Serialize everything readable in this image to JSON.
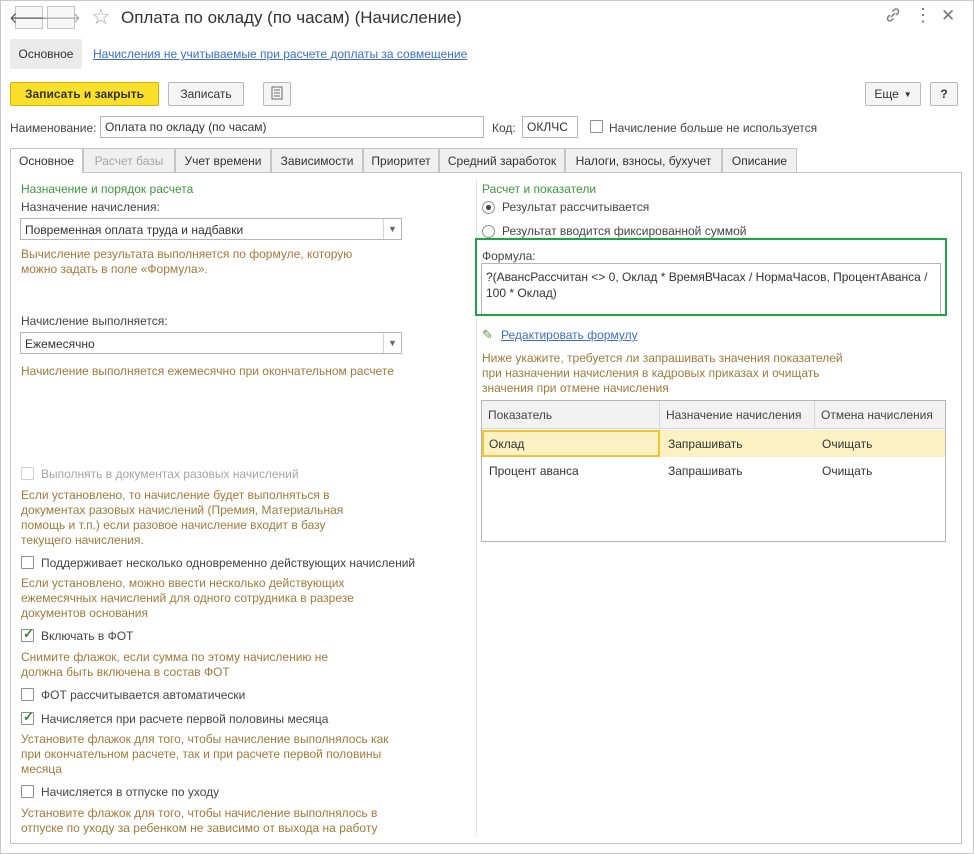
{
  "window": {
    "title": "Оплата по окладу (по часам) (Начисление)"
  },
  "section_nav": {
    "main": "Основное",
    "link": "Начисления не учитываемые при расчете доплаты за совмещение"
  },
  "toolbar": {
    "save_close": "Записать и закрыть",
    "save": "Записать",
    "more": "Еще",
    "help": "?"
  },
  "fields": {
    "name_label": "Наименование:",
    "name_value": "Оплата по окладу (по часам)",
    "code_label": "Код:",
    "code_value": "ОКЛЧС",
    "not_used_label": "Начисление больше не используется"
  },
  "tabs": [
    {
      "label": "Основное"
    },
    {
      "label": "Расчет базы"
    },
    {
      "label": "Учет времени"
    },
    {
      "label": "Зависимости"
    },
    {
      "label": "Приоритет"
    },
    {
      "label": "Средний заработок"
    },
    {
      "label": "Налоги, взносы, бухучет"
    },
    {
      "label": "Описание"
    }
  ],
  "left": {
    "group_title": "Назначение и порядок расчета",
    "purpose_label": "Назначение начисления:",
    "purpose_value": "Повременная оплата труда и надбавки",
    "purpose_hint": "Вычисление результата выполняется по формуле, которую можно задать в поле «Формула».",
    "period_label": "Начисление выполняется:",
    "period_value": "Ежемесячно",
    "period_hint": "Начисление выполняется ежемесячно при окончательном расчете",
    "cb1_label": "Выполнять в документах разовых начислений",
    "cb1_hint": "Если установлено, то начисление будет выполняться в документах разовых начислений (Премия, Материальная помощь и т.п.) если разовое начисление входит в базу текущего начисления.",
    "cb2_label": "Поддерживает несколько одновременно действующих начислений",
    "cb2_hint": "Если установлено, можно ввести несколько действующих ежемесячных начислений для одного сотрудника в разрезе документов основания",
    "cb3_label": "Включать в ФОТ",
    "cb3_hint": "Снимите флажок, если сумма по этому начислению не должна быть включена в состав ФОТ",
    "cb4_label": "ФОТ рассчитывается автоматически",
    "cb5_label": "Начисляется при расчете первой половины месяца",
    "cb5_hint": "Установите флажок для того, чтобы начисление выполнялось как при окончательном расчете, так и при расчете первой половины месяца",
    "cb6_label": "Начисляется в отпуске по уходу",
    "cb6_hint": "Установите флажок для того, чтобы начисление выполнялось в отпуске по уходу за ребенком не зависимо от выхода на работу"
  },
  "right": {
    "group_title": "Расчет и показатели",
    "radio1": "Результат рассчитывается",
    "radio2": "Результат вводится фиксированной суммой",
    "formula_label": "Формула:",
    "formula_value": "?(АвансРассчитан <> 0, Оклад * ВремяВЧасах / НормаЧасов, ПроцентАванса / 100 * Оклад)",
    "edit_formula": "Редактировать формулу",
    "indicators_hint": "Ниже укажите, требуется ли запрашивать значения показателей при назначении начисления в кадровых приказах и очищать значения при отмене начисления",
    "table": {
      "headers": [
        "Показатель",
        "Назначение начисления",
        "Отмена начисления"
      ],
      "rows": [
        [
          "Оклад",
          "Запрашивать",
          "Очищать"
        ],
        [
          "Процент аванса",
          "Запрашивать",
          "Очищать"
        ]
      ]
    }
  }
}
